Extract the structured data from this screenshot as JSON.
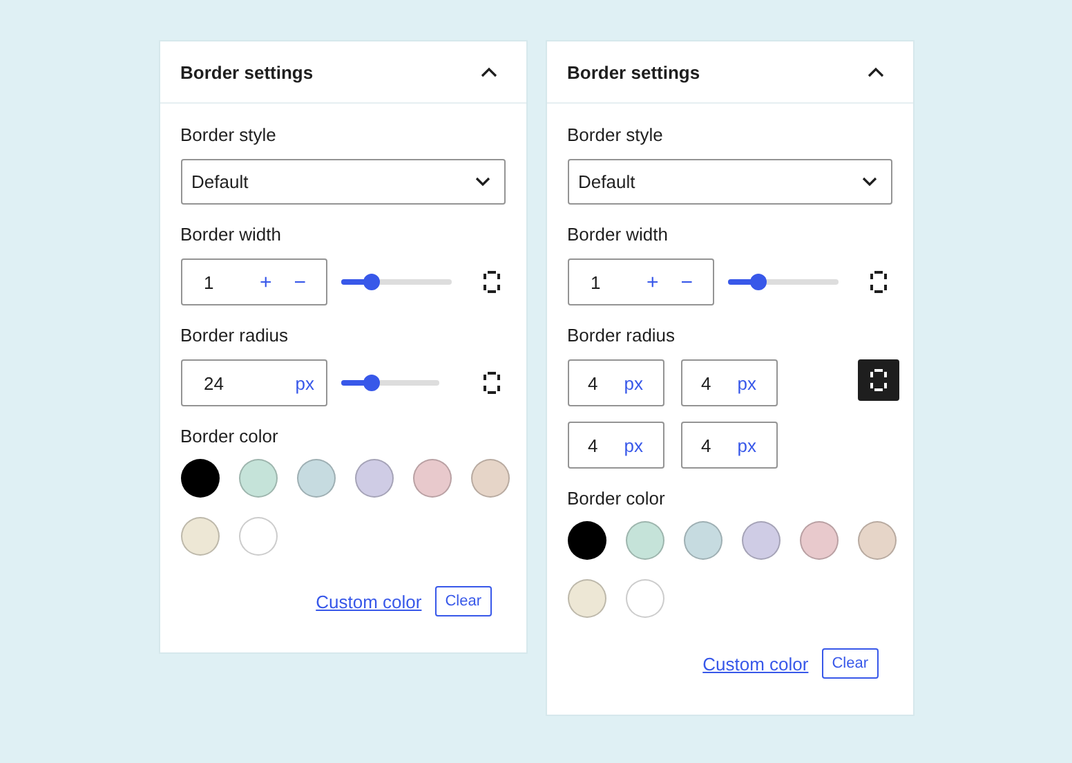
{
  "panels": [
    {
      "title": "Border settings",
      "expanded": true,
      "style": {
        "label": "Border style",
        "value": "Default"
      },
      "width": {
        "label": "Border width",
        "value": "1",
        "increment": "+",
        "decrement": "−",
        "level": 0.28,
        "split_selected": false
      },
      "radius": {
        "label": "Border radius",
        "split_selected": false,
        "level": 0.32,
        "fields": [
          {
            "value": "24",
            "unit": "px"
          }
        ]
      },
      "color": {
        "label": "Border color",
        "swatches": [
          {
            "color": "#000000"
          },
          {
            "color": "#c5e3d9"
          },
          {
            "color": "#c6dbe0"
          },
          {
            "color": "#cfcce5"
          },
          {
            "color": "#e8c9cc"
          },
          {
            "color": "#e6d5c8"
          },
          {
            "color": "#ede7d5"
          },
          {
            "color": "#ffffff"
          }
        ],
        "custom": "Custom color",
        "clear": "Clear"
      }
    },
    {
      "title": "Border settings",
      "expanded": true,
      "style": {
        "label": "Border style",
        "value": "Default"
      },
      "width": {
        "label": "Border width",
        "value": "1",
        "increment": "+",
        "decrement": "−",
        "level": 0.28,
        "split_selected": false
      },
      "radius": {
        "label": "Border radius",
        "split_selected": true,
        "fields": [
          {
            "value": "4",
            "unit": "px"
          },
          {
            "value": "4",
            "unit": "px"
          },
          {
            "value": "4",
            "unit": "px"
          },
          {
            "value": "4",
            "unit": "px"
          }
        ]
      },
      "color": {
        "label": "Border color",
        "swatches": [
          {
            "color": "#000000"
          },
          {
            "color": "#c5e3d9"
          },
          {
            "color": "#c6dbe0"
          },
          {
            "color": "#cfcce5"
          },
          {
            "color": "#e8c9cc"
          },
          {
            "color": "#e6d5c8"
          },
          {
            "color": "#ede7d5"
          },
          {
            "color": "#ffffff"
          }
        ],
        "custom": "Custom color",
        "clear": "Clear"
      }
    }
  ]
}
